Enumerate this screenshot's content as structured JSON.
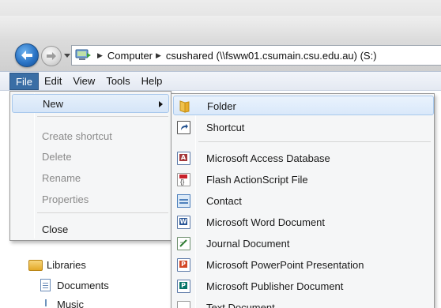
{
  "address": {
    "crumbs": [
      "Computer",
      "csushared (\\\\fsww01.csumain.csu.edu.au) (S:)"
    ]
  },
  "menubar": {
    "items": [
      {
        "label": "File",
        "active": true
      },
      {
        "label": "Edit"
      },
      {
        "label": "View"
      },
      {
        "label": "Tools"
      },
      {
        "label": "Help"
      }
    ]
  },
  "file_menu": {
    "items": [
      {
        "label": "New",
        "enabled": true,
        "submenu": true
      },
      {
        "label": "Create shortcut",
        "enabled": false
      },
      {
        "label": "Delete",
        "enabled": false
      },
      {
        "label": "Rename",
        "enabled": false
      },
      {
        "label": "Properties",
        "enabled": false
      },
      {
        "label": "Close",
        "enabled": true
      }
    ]
  },
  "new_submenu": {
    "items": [
      {
        "label": "Folder",
        "icon": "folder-icon"
      },
      {
        "label": "Shortcut",
        "icon": "shortcut-icon"
      },
      {
        "label": "Microsoft Access Database",
        "icon": "access-icon"
      },
      {
        "label": "Flash ActionScript File",
        "icon": "actionscript-icon"
      },
      {
        "label": "Contact",
        "icon": "contact-icon"
      },
      {
        "label": "Microsoft Word Document",
        "icon": "word-icon"
      },
      {
        "label": "Journal Document",
        "icon": "journal-icon"
      },
      {
        "label": "Microsoft PowerPoint Presentation",
        "icon": "powerpoint-icon"
      },
      {
        "label": "Microsoft Publisher Document",
        "icon": "publisher-icon"
      },
      {
        "label": "Text Document",
        "icon": "text-document-icon"
      }
    ]
  },
  "tree": {
    "libraries": "Libraries",
    "documents": "Documents",
    "music": "Music"
  },
  "colors": {
    "menu_active": "#3a6ea5",
    "highlight_border": "#a8c8ec"
  }
}
